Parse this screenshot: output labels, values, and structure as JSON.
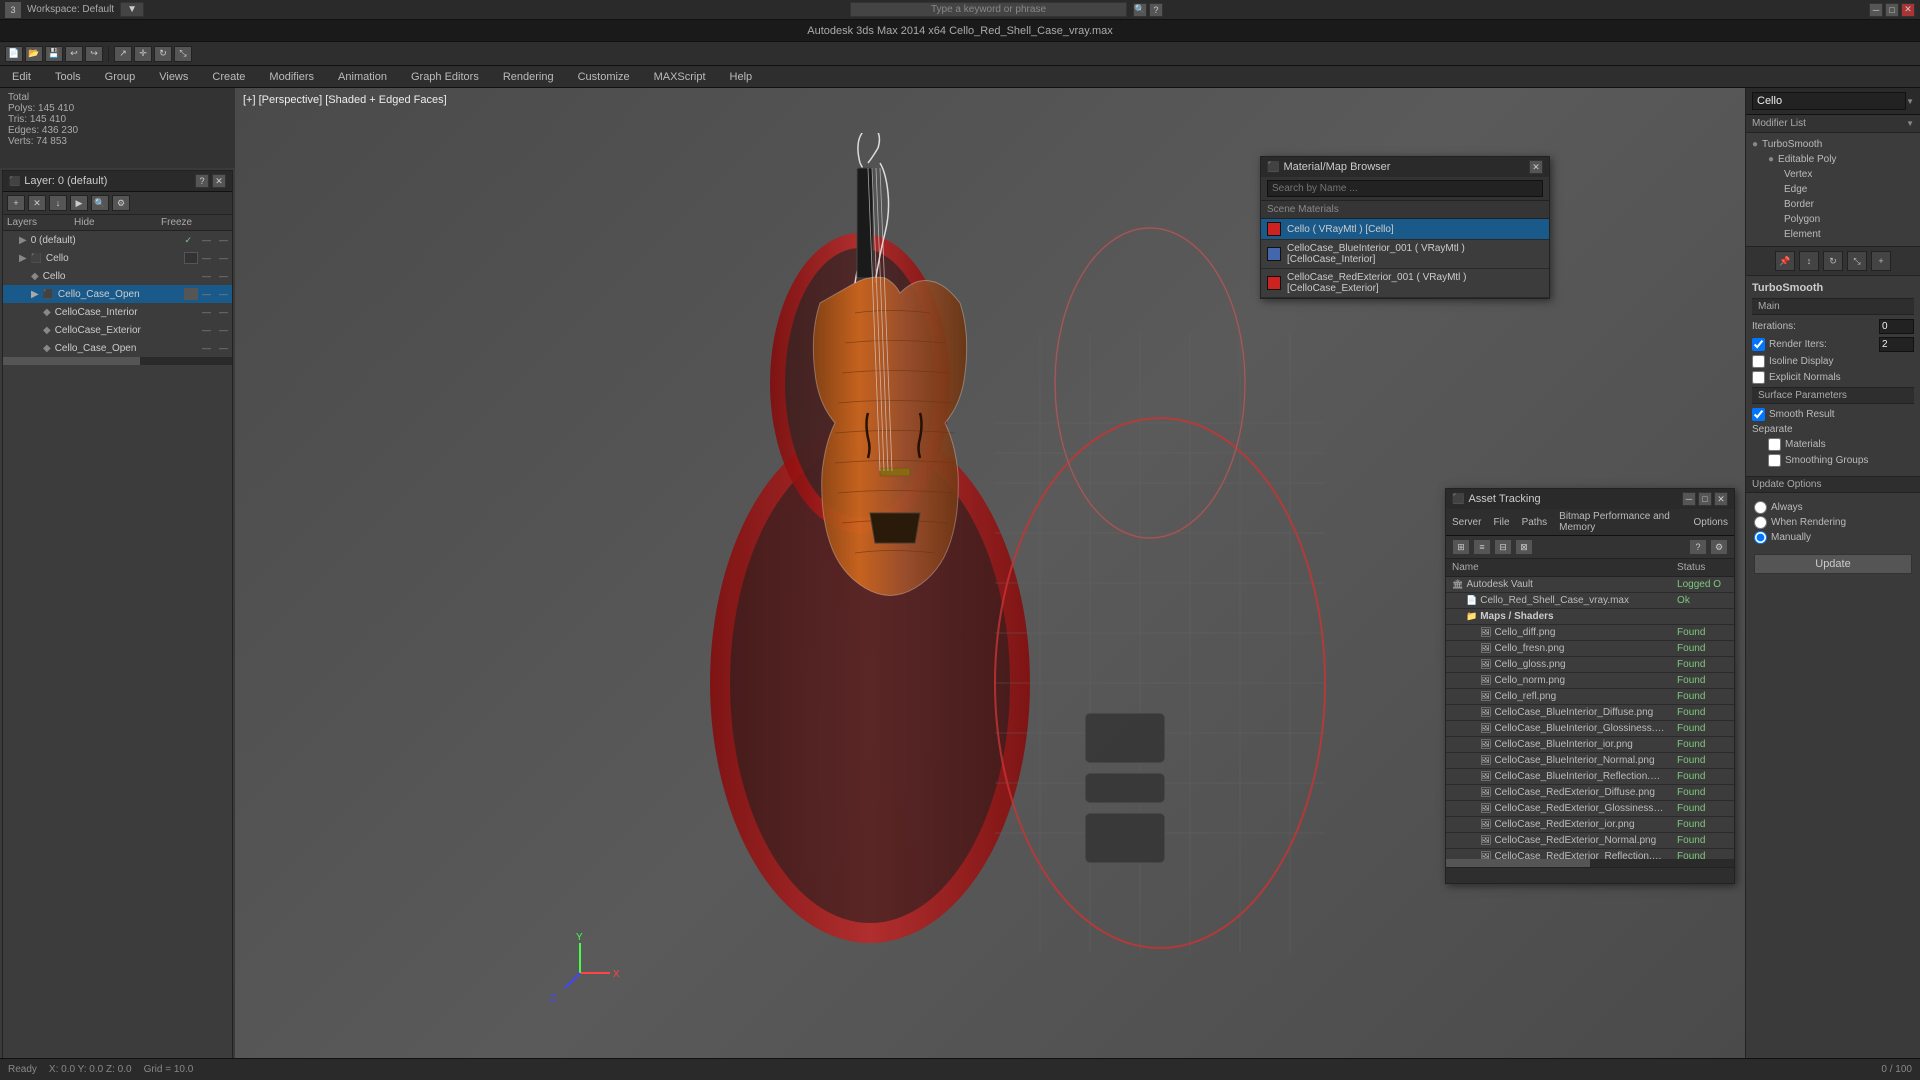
{
  "window": {
    "title": "Autodesk 3ds Max 2014 x64   Cello_Red_Shell_Case_vray.max",
    "workspace": "Workspace: Default"
  },
  "menu": {
    "items": [
      "Edit",
      "Tools",
      "Group",
      "Views",
      "Create",
      "Modifiers",
      "Animation",
      "Graph Editors",
      "Rendering",
      "Customize",
      "MAXScript",
      "Help"
    ]
  },
  "stats": {
    "total_label": "Total",
    "polys_label": "Polys:",
    "polys_value": "145 410",
    "tris_label": "Tris:",
    "tris_value": "145 410",
    "edges_label": "Edges:",
    "edges_value": "436 230",
    "verts_label": "Verts:",
    "verts_value": "74 853"
  },
  "layer_panel": {
    "title": "Layer: 0 (default)",
    "columns": {
      "name": "Layers",
      "hide": "Hide",
      "freeze": "Freeze"
    },
    "layers": [
      {
        "id": "l0",
        "name": "0 (default)",
        "indent": 0,
        "checkmark": true
      },
      {
        "id": "cello-grp",
        "name": "Cello",
        "indent": 1,
        "checkbox": true
      },
      {
        "id": "cello",
        "name": "Cello",
        "indent": 2
      },
      {
        "id": "cello-case-open",
        "name": "Cello_Case_Open",
        "indent": 2,
        "selected": true,
        "checkbox": true
      },
      {
        "id": "celloc-interior",
        "name": "CelloCase_Interior",
        "indent": 3
      },
      {
        "id": "celloc-exterior",
        "name": "CelloCase_Exterior",
        "indent": 3
      },
      {
        "id": "cello-case-open2",
        "name": "Cello_Case_Open",
        "indent": 3
      }
    ]
  },
  "viewport": {
    "label": "[+] [Perspective] [Shaded + Edged Faces]"
  },
  "modifier_panel": {
    "search_placeholder": "Cello",
    "modifier_list_label": "Modifier List",
    "tree": [
      {
        "label": "TurboSmooth",
        "indent": 0,
        "bullet": "●"
      },
      {
        "label": "Editable Poly",
        "indent": 1,
        "bullet": "●"
      },
      {
        "label": "Vertex",
        "indent": 2
      },
      {
        "label": "Edge",
        "indent": 2
      },
      {
        "label": "Border",
        "indent": 2
      },
      {
        "label": "Polygon",
        "indent": 2
      },
      {
        "label": "Element",
        "indent": 2
      }
    ],
    "turbosmooth": {
      "title": "TurboSmooth",
      "main_label": "Main",
      "iterations_label": "Iterations:",
      "iterations_value": "0",
      "render_iters_label": "Render Iters:",
      "render_iters_value": "2",
      "render_iters_checked": true,
      "isoline_label": "Isoline Display",
      "explicit_label": "Explicit Normals",
      "surface_title": "Surface Parameters",
      "smooth_result_label": "Smooth Result",
      "smooth_result_checked": true,
      "separate_label": "Separate",
      "materials_label": "Materials",
      "smoothing_label": "Smoothing Groups"
    },
    "update_options": {
      "title": "Update Options",
      "always_label": "Always",
      "when_rendering_label": "When Rendering",
      "manually_label": "Manually",
      "manually_checked": true,
      "update_btn": "Update"
    }
  },
  "material_browser": {
    "title": "Material/Map Browser",
    "search_placeholder": "Search by Name ...",
    "scene_materials_label": "Scene Materials",
    "materials": [
      {
        "name": "Cello  ( VRayMtl )  [Cello]",
        "color": "#cc2222",
        "active": true
      },
      {
        "name": "CelloCase_BlueInterior_001 ( VRayMtl ) [CelloCase_Interior]",
        "color": "#4466aa"
      },
      {
        "name": "CelloCase_RedExterior_001 ( VRayMtl ) [CelloCase_Exterior]",
        "color": "#cc2222"
      }
    ]
  },
  "asset_tracking": {
    "title": "Asset Tracking",
    "menu_items": [
      "Server",
      "File",
      "Paths",
      "Bitmap Performance and Memory",
      "Options"
    ],
    "toolbar_icons": [
      "grid1",
      "grid2",
      "grid3",
      "grid4"
    ],
    "columns": [
      "Name",
      "Status"
    ],
    "assets": [
      {
        "id": "vault",
        "name": "Autodesk Vault",
        "status": "Logged O",
        "indent": 0,
        "type": "vault"
      },
      {
        "id": "max-file",
        "name": "Cello_Red_Shell_Case_vray.max",
        "status": "Ok",
        "indent": 1,
        "type": "file"
      },
      {
        "id": "maps-folder",
        "name": "Maps / Shaders",
        "status": "",
        "indent": 1,
        "type": "folder"
      },
      {
        "id": "cello-diff",
        "name": "Cello_diff.png",
        "status": "Found",
        "indent": 2,
        "type": "image"
      },
      {
        "id": "cello-fresn",
        "name": "Cello_fresn.png",
        "status": "Found",
        "indent": 2,
        "type": "image"
      },
      {
        "id": "cello-gloss",
        "name": "Cello_gloss.png",
        "status": "Found",
        "indent": 2,
        "type": "image"
      },
      {
        "id": "cello-norm",
        "name": "Cello_norm.png",
        "status": "Found",
        "indent": 2,
        "type": "image"
      },
      {
        "id": "cello-refl",
        "name": "Cello_refl.png",
        "status": "Found",
        "indent": 2,
        "type": "image"
      },
      {
        "id": "case-blue-diff",
        "name": "CelloCase_BlueInterior_Diffuse.png",
        "status": "Found",
        "indent": 2,
        "type": "image"
      },
      {
        "id": "case-blue-gloss",
        "name": "CelloCase_BlueInterior_Glossiness.png",
        "status": "Found",
        "indent": 2,
        "type": "image"
      },
      {
        "id": "case-blue-ior",
        "name": "CelloCase_BlueInterior_ior.png",
        "status": "Found",
        "indent": 2,
        "type": "image"
      },
      {
        "id": "case-blue-norm",
        "name": "CelloCase_BlueInterior_Normal.png",
        "status": "Found",
        "indent": 2,
        "type": "image"
      },
      {
        "id": "case-blue-refl",
        "name": "CelloCase_BlueInterior_Reflection.png",
        "status": "Found",
        "indent": 2,
        "type": "image"
      },
      {
        "id": "case-red-diff",
        "name": "CelloCase_RedExterior_Diffuse.png",
        "status": "Found",
        "indent": 2,
        "type": "image"
      },
      {
        "id": "case-red-gloss",
        "name": "CelloCase_RedExterior_Glossiness.png",
        "status": "Found",
        "indent": 2,
        "type": "image"
      },
      {
        "id": "case-red-ior",
        "name": "CelloCase_RedExterior_ior.png",
        "status": "Found",
        "indent": 2,
        "type": "image"
      },
      {
        "id": "case-red-norm",
        "name": "CelloCase_RedExterior_Normal.png",
        "status": "Found",
        "indent": 2,
        "type": "image"
      },
      {
        "id": "case-red-refl",
        "name": "CelloCase_RedExterior_Reflection.png",
        "status": "Found",
        "indent": 2,
        "type": "image"
      }
    ]
  },
  "icons": {
    "close": "✕",
    "minimize": "─",
    "maximize": "□",
    "arrow_down": "▼",
    "arrow_right": "▶",
    "bullet": "●",
    "check": "✓",
    "folder": "📁",
    "file": "📄",
    "image": "🖼",
    "gear": "⚙",
    "question": "?",
    "search": "🔍"
  },
  "colors": {
    "accent_blue": "#1a5a8a",
    "selection_blue": "#2a6a9a",
    "status_found": "#7ec87e",
    "status_ok": "#7ec87e",
    "mat_red": "#cc2222",
    "mat_blue": "#4466aa"
  }
}
